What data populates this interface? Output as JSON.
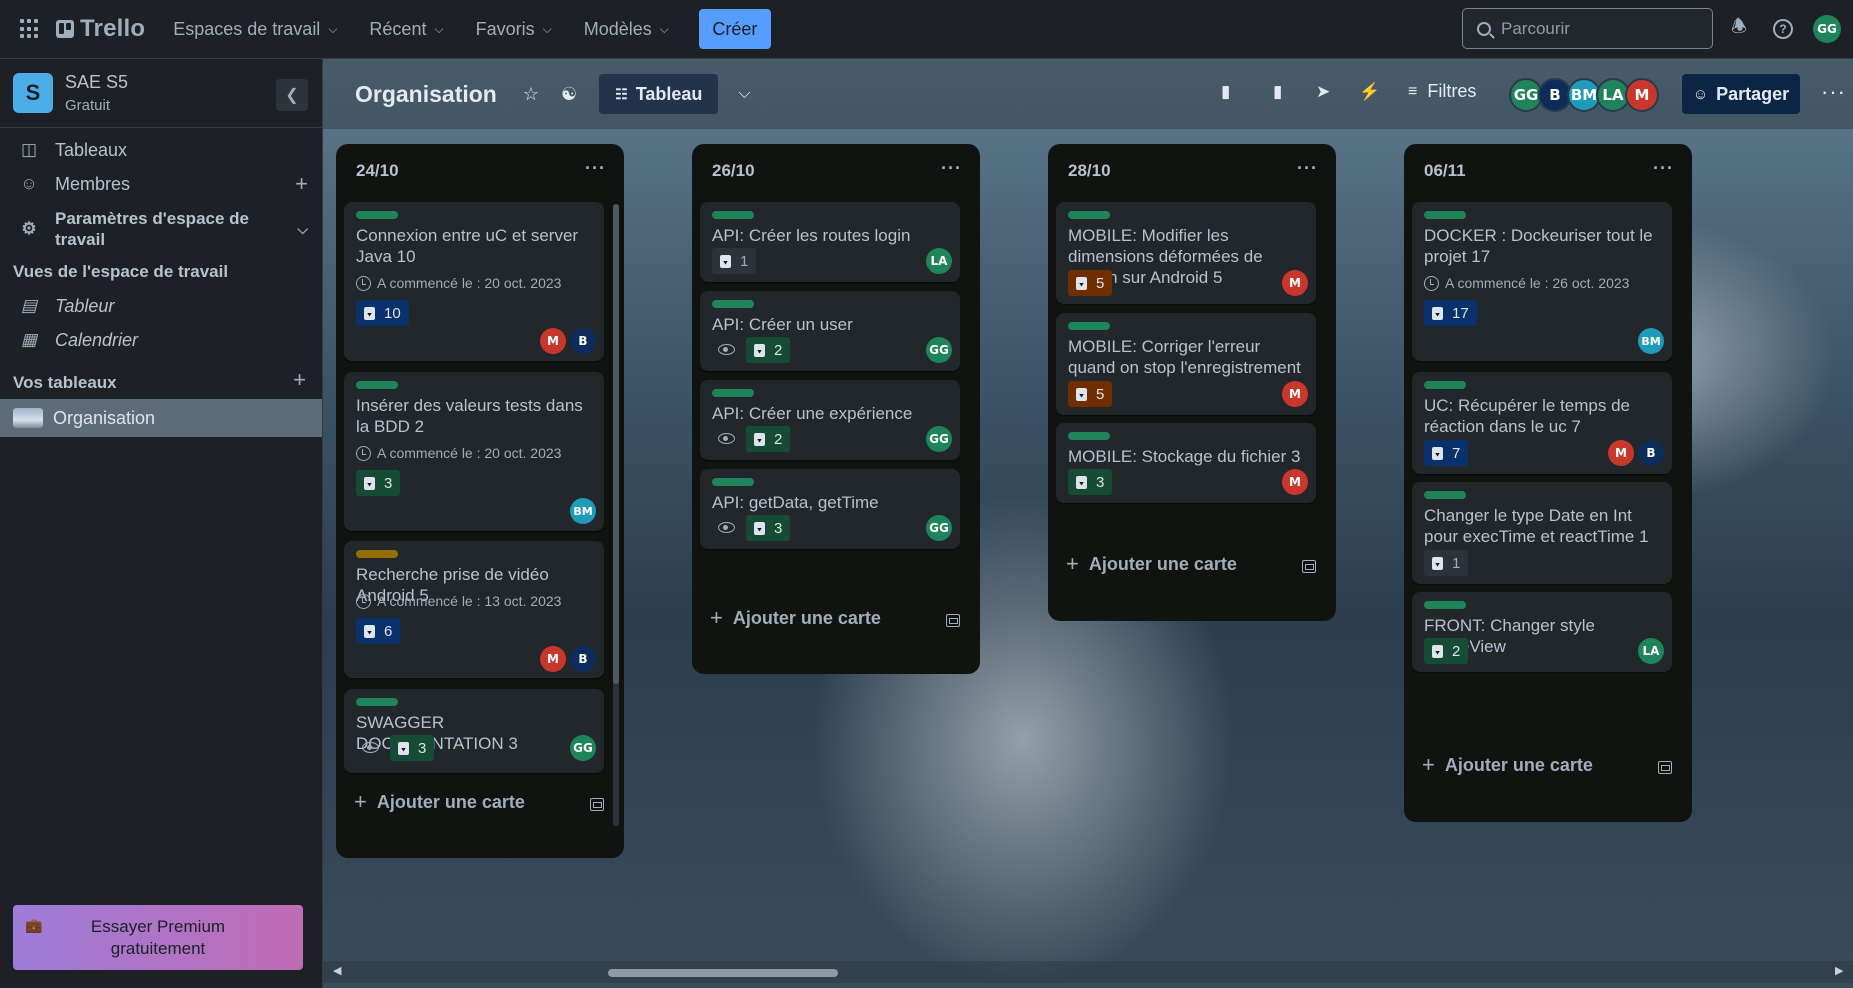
{
  "topbar": {
    "logo": "Trello",
    "nav": [
      {
        "label": "Espaces de travail"
      },
      {
        "label": "Récent"
      },
      {
        "label": "Favoris"
      },
      {
        "label": "Modèles"
      }
    ],
    "create_label": "Créer",
    "search_placeholder": "Parcourir",
    "user_initials": "GG",
    "user_color": "#1f845a"
  },
  "sidebar": {
    "workspace_initial": "S",
    "workspace_name": "SAE S5",
    "workspace_plan": "Gratuit",
    "items": [
      {
        "label": "Tableaux"
      },
      {
        "label": "Membres"
      },
      {
        "label": "Paramètres d'espace de travail"
      }
    ],
    "views_title": "Vues de l'espace de travail",
    "views": [
      {
        "label": "Tableur"
      },
      {
        "label": "Calendrier"
      }
    ],
    "boards_title": "Vos tableaux",
    "boards": [
      {
        "label": "Organisation"
      }
    ],
    "premium_label": "Essayer Premium gratuitement"
  },
  "board": {
    "title": "Organisation",
    "view_label": "Tableau",
    "filters_label": "Filtres",
    "share_label": "Partager",
    "members": [
      {
        "initials": "GG",
        "color": "#1f845a"
      },
      {
        "initials": "B",
        "color": "#0c2d5c"
      },
      {
        "initials": "BM",
        "color": "#1d9bb8"
      },
      {
        "initials": "LA",
        "color": "#1f845a"
      },
      {
        "initials": "M",
        "color": "#c9372c"
      }
    ]
  },
  "lists": [
    {
      "title": "24/10",
      "add_label": "Ajouter une carte",
      "cards": [
        {
          "title": "Connexion entre uC et server Java 10",
          "started": "A commencé le : 20 oct. 2023",
          "count": "10"
        },
        {
          "title": "Insérer des valeurs tests dans la BDD 2",
          "started": "A commencé le : 20 oct. 2023",
          "count": "3"
        },
        {
          "title": "Recherche prise de vidéo Android 5",
          "started": "A commencé le : 13 oct. 2023",
          "count": "6"
        },
        {
          "title": "SWAGGER DOCUMENTATION 3",
          "count": "3"
        }
      ]
    },
    {
      "title": "26/10",
      "add_label": "Ajouter une carte",
      "cards": [
        {
          "title": "API: Créer les routes login",
          "count": "1"
        },
        {
          "title": "API: Créer un user",
          "count": "2"
        },
        {
          "title": "API: Créer une expérience",
          "count": "2"
        },
        {
          "title": "API: getData, getTime",
          "count": "3"
        }
      ]
    },
    {
      "title": "28/10",
      "add_label": "Ajouter une carte",
      "cards": [
        {
          "title": "MOBILE: Modifier les dimensions déformées de l'écran sur Android 5",
          "count": "5"
        },
        {
          "title": "MOBILE: Corriger l'erreur quand on stop l'enregistrement 5",
          "count": "5"
        },
        {
          "title": "MOBILE: Stockage du fichier 3",
          "count": "3"
        }
      ]
    },
    {
      "title": "06/11",
      "add_label": "Ajouter une carte",
      "cards": [
        {
          "title": "DOCKER : Dockeuriser tout le projet 17",
          "started": "A commencé le : 26 oct. 2023",
          "count": "17"
        },
        {
          "title": "UC: Récupérer le temps de réaction dans le uc 7",
          "count": "7"
        },
        {
          "title": "Changer le type Date en Int pour execTime et reactTime 1",
          "count": "1"
        },
        {
          "title": "FRONT: Changer style HomeView",
          "count": "2"
        }
      ]
    }
  ],
  "avatars": {
    "M": {
      "initials": "M",
      "color": "#c9372c"
    },
    "B": {
      "initials": "B",
      "color": "#0c2d5c"
    },
    "BM": {
      "initials": "BM",
      "color": "#1d9bb8"
    },
    "GG": {
      "initials": "GG",
      "color": "#1f845a"
    },
    "LA": {
      "initials": "LA",
      "color": "#1f845a"
    }
  }
}
